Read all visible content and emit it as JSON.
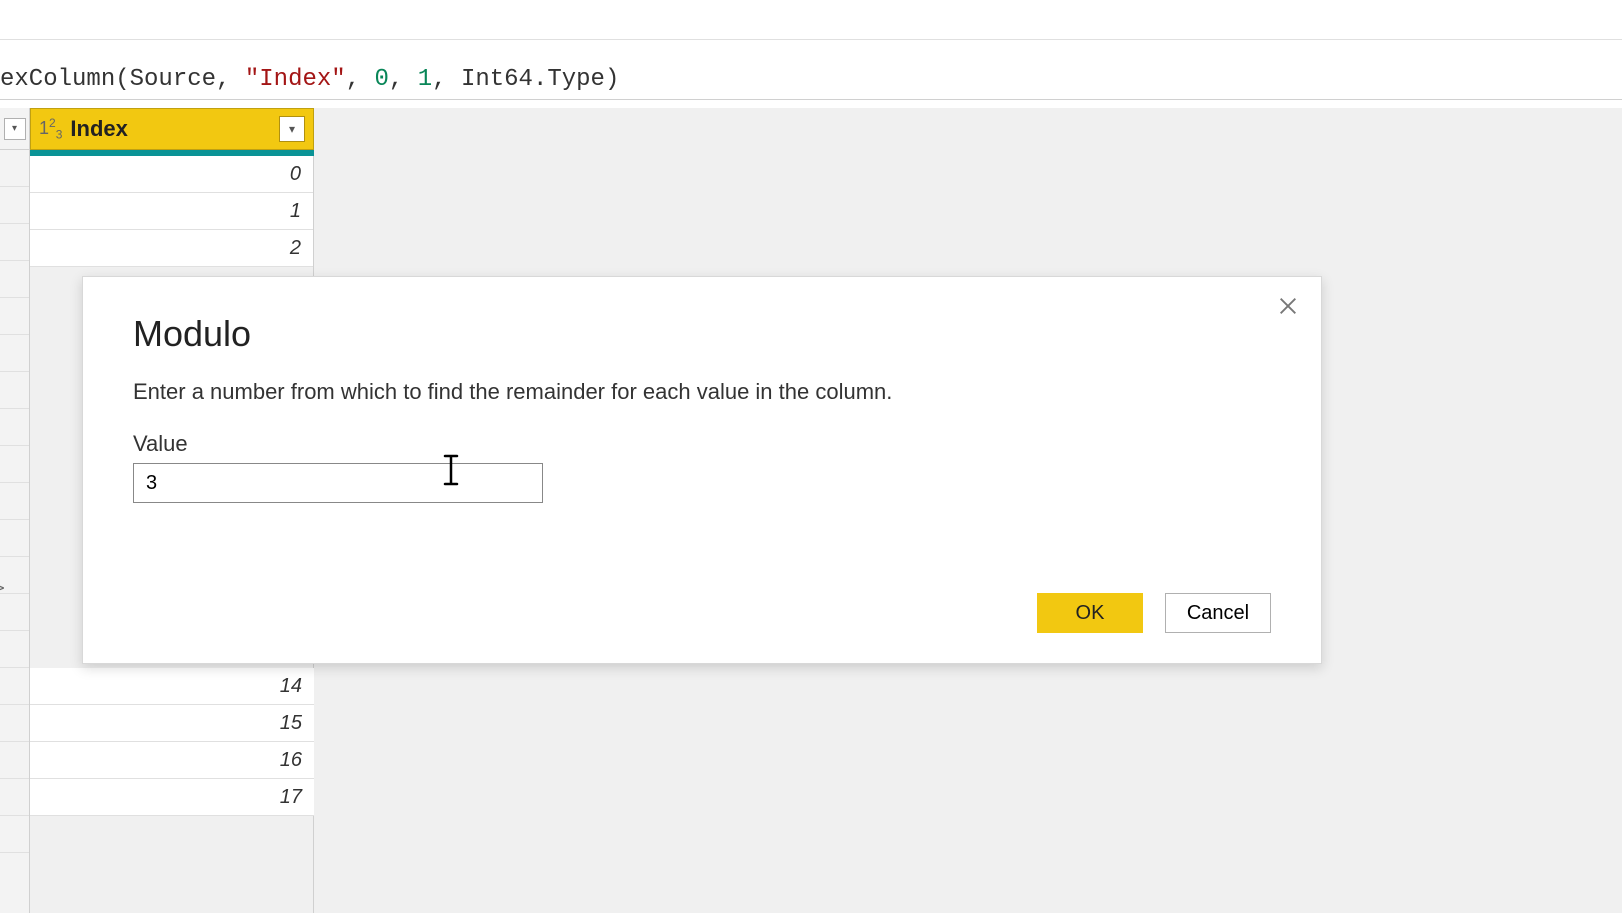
{
  "formula": {
    "prefix": "exColumn",
    "source": "Source",
    "col_name": "\"Index\"",
    "start": "0",
    "step": "1",
    "type": "Int64.Type"
  },
  "column": {
    "type_icon": "1²₃",
    "name": "Index"
  },
  "data_rows_top": [
    "0",
    "1",
    "2"
  ],
  "data_rows_bottom": [
    "14",
    "15",
    "16",
    "17"
  ],
  "dialog": {
    "title": "Modulo",
    "description": "Enter a number from which to find the remainder for each value in the column.",
    "field_label": "Value",
    "field_value": "3",
    "ok_label": "OK",
    "cancel_label": "Cancel"
  },
  "arrow_char": ">"
}
